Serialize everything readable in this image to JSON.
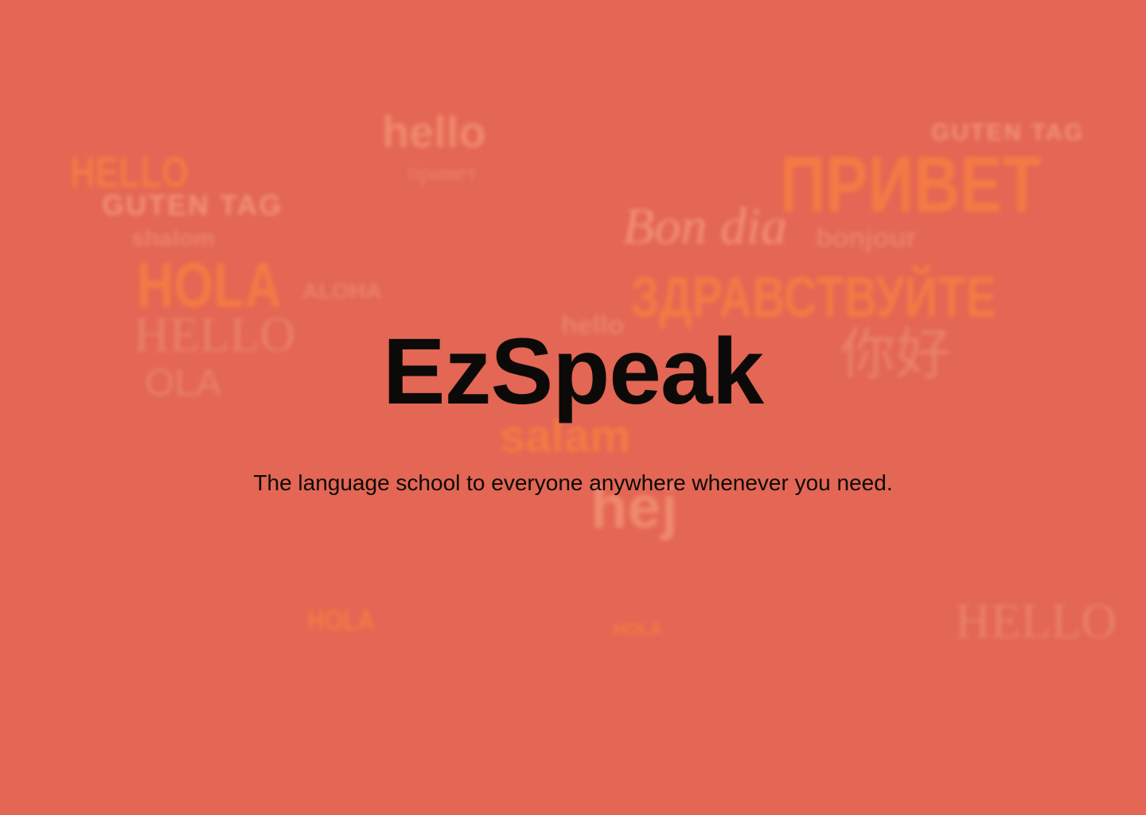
{
  "hero": {
    "title": "EzSpeak",
    "subtitle": "The language school to everyone anywhere whenever you need."
  },
  "background": {
    "words": [
      "hello",
      "HELLO",
      "GUTEN TAG",
      "shalom",
      "HOLA",
      "HELLO",
      "OLA",
      "ALOHA",
      "привет",
      "Bon dia",
      "bonjour",
      "ПРИВЕТ",
      "GUTEN TAG",
      "ЗДРАВСТВУЙТЕ",
      "你好",
      "salam",
      "hej",
      "HOLA",
      "HELLO",
      "hello",
      "HOLA"
    ]
  },
  "colors": {
    "background": "#e46654",
    "text": "#0b0a09",
    "word_orange": "#f47a45",
    "word_light": "#ef8a6d"
  }
}
